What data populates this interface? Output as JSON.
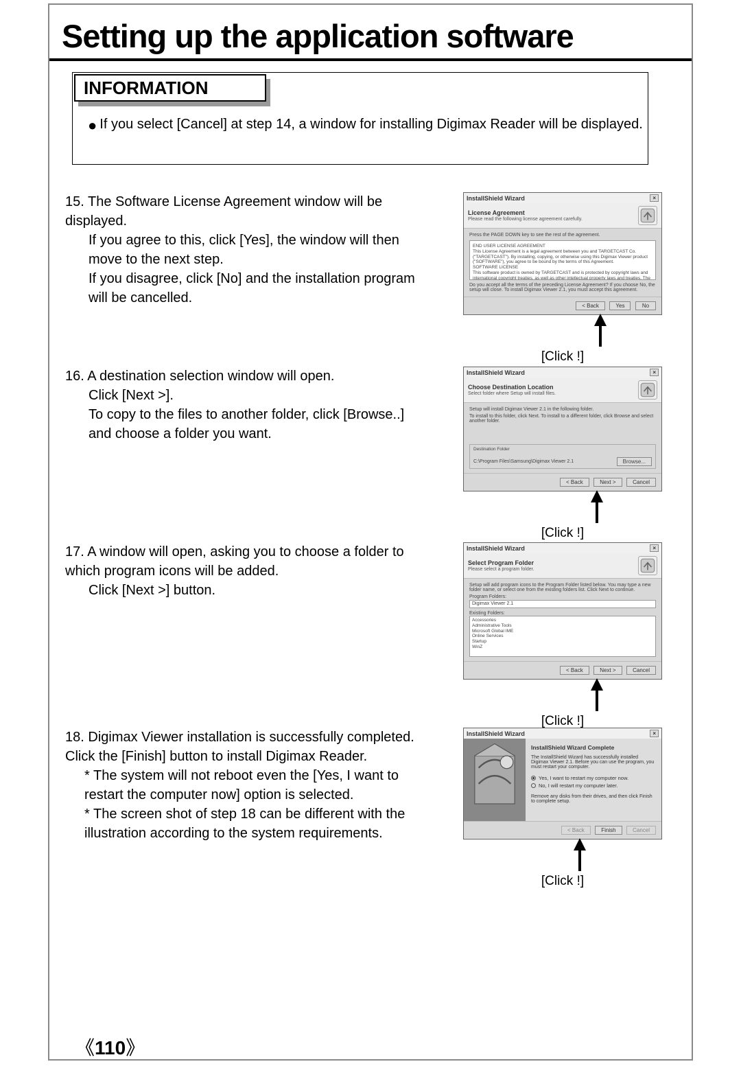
{
  "title": "Setting up the application software",
  "info": {
    "header": "INFORMATION",
    "bullet": "If you select [Cancel] at step 14, a window for installing Digimax Reader will be displayed."
  },
  "steps": {
    "s15": {
      "num": "15.",
      "l1": "The Software License Agreement window will be displayed.",
      "l2": "If you agree to this, click [Yes], the window will then move to the next step.",
      "l3": "If you disagree, click [No] and the installation program will be cancelled.",
      "click": "[Click !]"
    },
    "s16": {
      "num": "16.",
      "l1": "A destination selection window will open.",
      "l2": "Click [Next >].",
      "l3": "To copy to the files to another folder, click [Browse..] and choose a folder you want.",
      "click": "[Click !]"
    },
    "s17": {
      "num": "17.",
      "l1": "A window will open, asking you to choose a folder to which program icons will be added.",
      "l2": "Click [Next >] button.",
      "click": "[Click !]"
    },
    "s18": {
      "num": "18.",
      "l1": "Digimax Viewer installation is successfully completed. Click the [Finish] button to install Digimax Reader.",
      "n1": "* The system will not reboot even the [Yes, I want to restart the computer now] option is selected.",
      "n2": "* The screen shot of step 18 can be different with the illustration according to the system requirements.",
      "click": "[Click !]"
    }
  },
  "dialogs": {
    "d15": {
      "title": "InstallShield Wizard",
      "headerTitle": "License Agreement",
      "headerSub": "Please read the following license agreement carefully.",
      "bodyTop": "Press the PAGE DOWN key to see the rest of the agreement.",
      "agreement": "END USER LICENSE AGREEMENT\nThis License Agreement is a legal agreement between you and TARGETCAST Co. (\"TARGETCAST\"). By installing, copying, or otherwise using this Digimax Viewer product (\"SOFTWARE\"), you agree to be bound by the terms of this Agreement.\nSOFTWARE LICENSE\nThis software product is owned by TARGETCAST and is protected by copyright laws and international copyright treaties, as well as other intellectual property laws and treaties. The ...",
      "bodyBottom": "Do you accept all the terms of the preceding License Agreement? If you choose No, the setup will close. To install Digimax Viewer 2.1, you must accept this agreement.",
      "btnBack": "< Back",
      "btnYes": "Yes",
      "btnNo": "No"
    },
    "d16": {
      "title": "InstallShield Wizard",
      "headerTitle": "Choose Destination Location",
      "headerSub": "Select folder where Setup will install files.",
      "body1": "Setup will install Digimax Viewer 2.1 in the following folder.",
      "body2": "To install to this folder, click Next. To install to a different folder, click Browse and select another folder.",
      "destLabel": "Destination Folder",
      "destPath": "C:\\Program Files\\Samsung\\Digimax Viewer 2.1",
      "btnBrowse": "Browse...",
      "btnBack": "< Back",
      "btnNext": "Next >",
      "btnCancel": "Cancel"
    },
    "d17": {
      "title": "InstallShield Wizard",
      "headerTitle": "Select Program Folder",
      "headerSub": "Please select a program folder.",
      "body1": "Setup will add program icons to the Program Folder listed below. You may type a new folder name, or select one from the existing folders list. Click Next to continue.",
      "pfLabel": "Program Folders:",
      "pfValue": "Digimax Viewer 2.1",
      "exLabel": "Existing Folders:",
      "exList": "Accessories\nAdministrative Tools\nMicrosoft Global IME\nOnline Services\nStartup\nWinZ",
      "btnBack": "< Back",
      "btnNext": "Next >",
      "btnCancel": "Cancel"
    },
    "d18": {
      "title": "InstallShield Wizard",
      "headerTitle": "InstallShield Wizard Complete",
      "body1": "The InstallShield Wizard has successfully installed Digimax Viewer 2.1. Before you can use the program, you must restart your computer.",
      "opt1": "Yes, I want to restart my computer now.",
      "opt2": "No, I will restart my computer later.",
      "body2": "Remove any disks from their drives, and then click Finish to complete setup.",
      "btnBack": "< Back",
      "btnFinish": "Finish",
      "btnCancel": "Cancel"
    }
  },
  "pageNum": "110"
}
